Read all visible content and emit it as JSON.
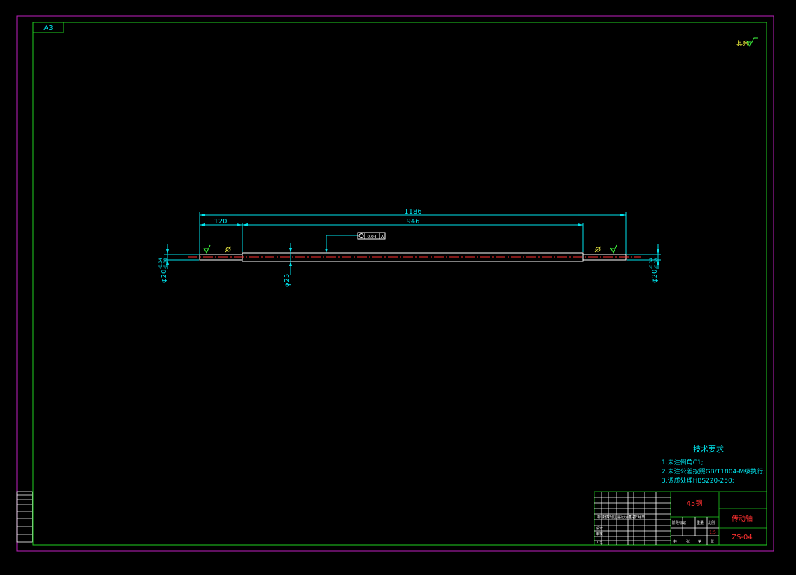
{
  "sheet": {
    "size_label": "A3",
    "colors": {
      "border_outer": "#c020c0",
      "border_inner": "#20d020",
      "dims": "#00e5ee",
      "centerline": "#ff3030",
      "part": "#ffffff",
      "symbol": "#e0e020"
    }
  },
  "surface_note": {
    "text": "其余",
    "symbol": "roughness-check-icon"
  },
  "dimensions": {
    "overall_length": "1186",
    "left_step_length": "120",
    "middle_length": "946",
    "left_diameter": "φ20",
    "left_diameter_tol_upper": "-0.04",
    "left_diameter_tol_lower": "-0.08",
    "middle_diameter": "φ25",
    "right_diameter": "φ20",
    "right_diameter_tol_upper": "-0.04",
    "right_diameter_tol_lower": "-0.08"
  },
  "geometric_tolerance": {
    "symbol": "circular-runout-icon",
    "value": "0.04",
    "datum": "A"
  },
  "technical_requirements": {
    "title": "技术要求",
    "items": [
      "1.未注倒角C1;",
      "2.未注公差按照GB/T1804-M级执行;",
      "3.调质处理HBS220-250;"
    ]
  },
  "title_block": {
    "material": "45钢",
    "part_name": "传动轴",
    "drawing_number": "ZS-04",
    "scale": "1:5",
    "header_row": [
      "标记",
      "处数",
      "分区",
      "更改文件号",
      "签名",
      "年月日"
    ],
    "role_rows": [
      "设计",
      "审核",
      "工艺"
    ],
    "stage_labels": [
      "阶段标记",
      "重量",
      "比例"
    ],
    "sheet_labels": [
      "共",
      "张",
      "第",
      "张"
    ]
  }
}
